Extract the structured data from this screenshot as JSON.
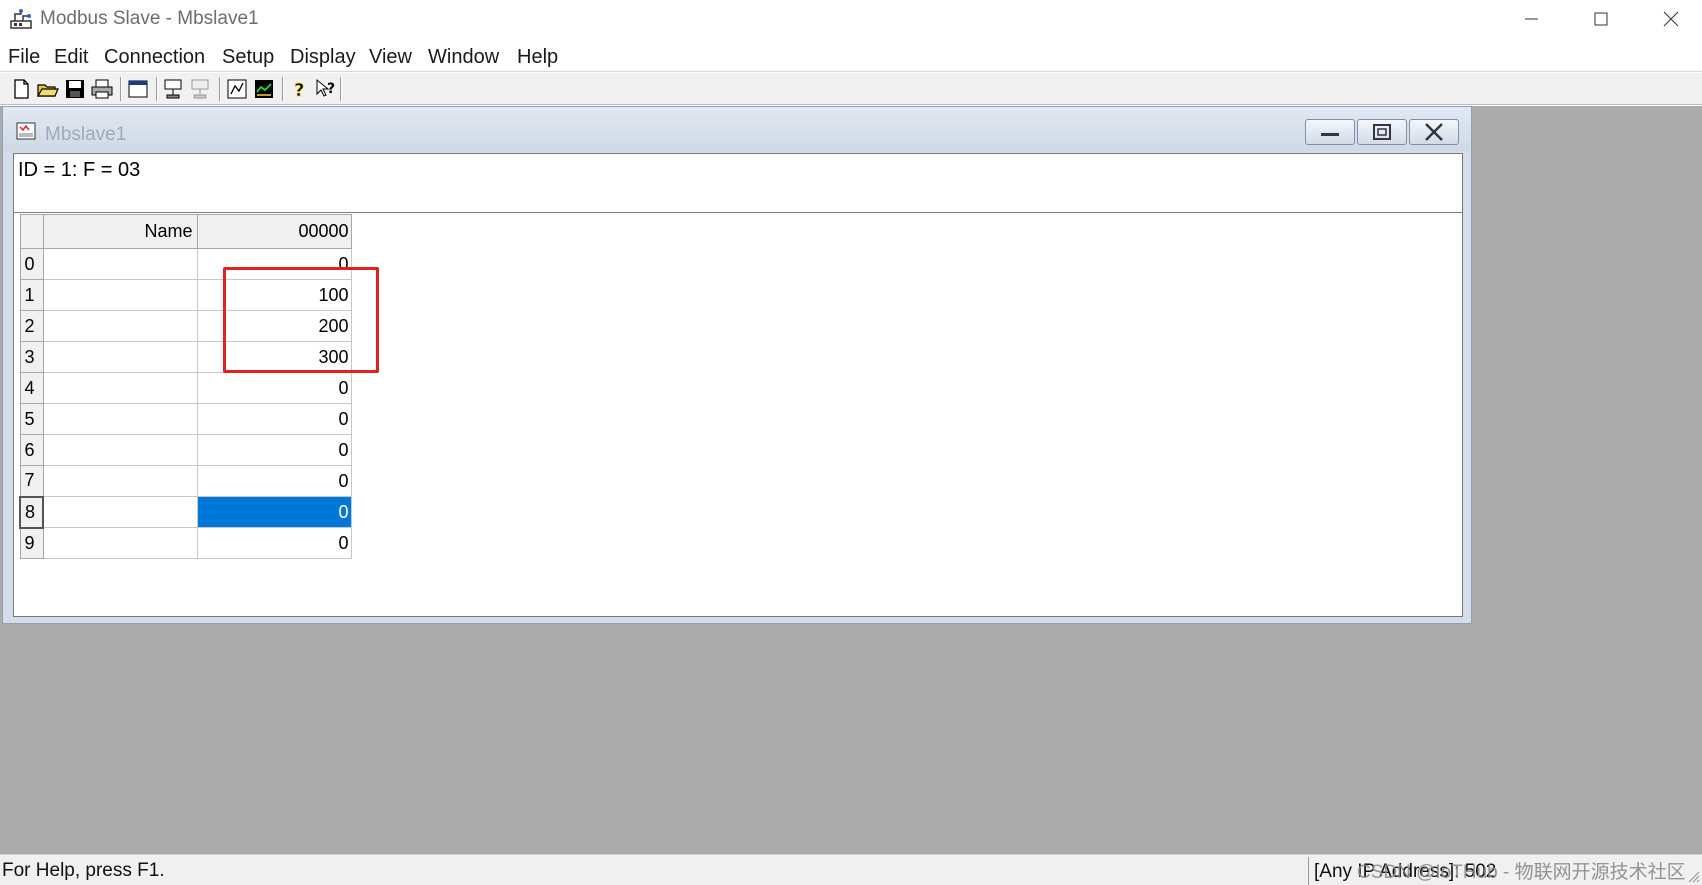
{
  "window": {
    "title": "Modbus Slave - Mbslave1"
  },
  "menu": [
    "File",
    "Edit",
    "Connection",
    "Setup",
    "Display",
    "View",
    "Window",
    "Help"
  ],
  "toolbar": {
    "icons": [
      "new-icon",
      "open-icon",
      "save-icon",
      "print-icon",
      "window-icon",
      "connect-icon",
      "disconnect-icon",
      "communication-icon",
      "monitor-icon",
      "help-icon",
      "context-help-icon"
    ]
  },
  "child": {
    "title": "Mbslave1",
    "info": "ID = 1: F = 03",
    "grid": {
      "name_header": "Name",
      "col_header": "00000",
      "rows": [
        {
          "index": "0",
          "name": "",
          "value": "0"
        },
        {
          "index": "1",
          "name": "",
          "value": "100"
        },
        {
          "index": "2",
          "name": "",
          "value": "200"
        },
        {
          "index": "3",
          "name": "",
          "value": "300"
        },
        {
          "index": "4",
          "name": "",
          "value": "0"
        },
        {
          "index": "5",
          "name": "",
          "value": "0"
        },
        {
          "index": "6",
          "name": "",
          "value": "0"
        },
        {
          "index": "7",
          "name": "",
          "value": "0"
        },
        {
          "index": "8",
          "name": "",
          "value": "0"
        },
        {
          "index": "9",
          "name": "",
          "value": "0"
        }
      ],
      "selected_row": 8
    }
  },
  "status": {
    "help": "For Help, press F1.",
    "address": "[Any IP Address]: 502",
    "watermark": "CSDN @IoTHub - 物联网开源技术社区"
  },
  "colors": {
    "selection": "#0078d7",
    "highlight_box": "#e0221f",
    "mdi_background": "#ababab"
  }
}
